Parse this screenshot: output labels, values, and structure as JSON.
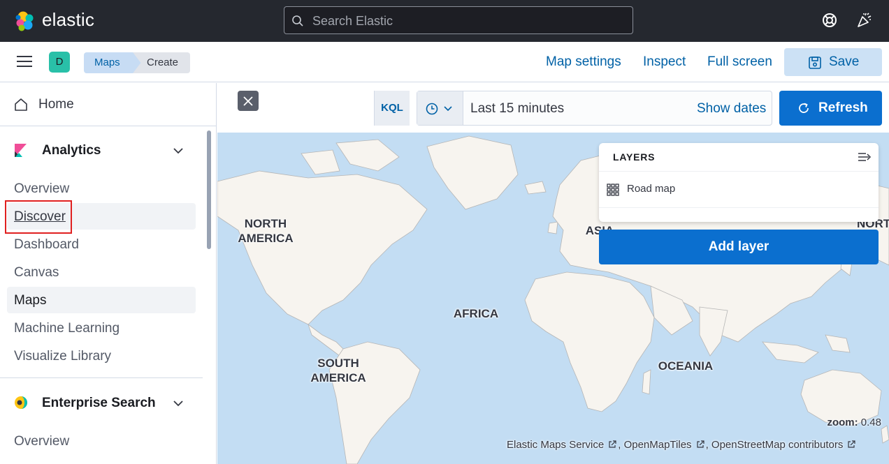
{
  "header": {
    "brand": "elastic",
    "search_placeholder": "Search Elastic",
    "icons": [
      "help-lifebuoy-icon",
      "news-feed-icon"
    ]
  },
  "toolbar": {
    "space_initial": "D",
    "breadcrumbs": [
      "Maps",
      "Create"
    ],
    "map_settings": "Map settings",
    "inspect": "Inspect",
    "full_screen": "Full screen",
    "save": "Save"
  },
  "sidebar": {
    "home": "Home",
    "groups": [
      {
        "title": "Analytics",
        "icon": "kibana-logo-icon",
        "items": [
          "Overview",
          "Discover",
          "Dashboard",
          "Canvas",
          "Maps",
          "Machine Learning",
          "Visualize Library"
        ],
        "active": "Maps",
        "highlighted": "Discover"
      },
      {
        "title": "Enterprise Search",
        "icon": "enterprise-search-logo-icon",
        "items": [
          "Overview"
        ]
      }
    ]
  },
  "query": {
    "language": "KQL",
    "time_range": "Last 15 minutes",
    "show_dates": "Show dates",
    "refresh": "Refresh"
  },
  "map": {
    "labels": {
      "north_america": "NORTH AMERICA",
      "south_america": "SOUTH AMERICA",
      "africa": "AFRICA",
      "asia": "ASIA",
      "oceania": "OCEANIA",
      "north_cut": "NORT R"
    },
    "layers_title": "LAYERS",
    "layers": [
      "Road map"
    ],
    "add_layer": "Add layer",
    "zoom_label": "zoom:",
    "zoom_value": "0.48",
    "attribution": [
      "Elastic Maps Service",
      "OpenMapTiles",
      "OpenStreetMap contributors"
    ]
  },
  "colors": {
    "header_bg": "#25282f",
    "primary": "#0b6fcf",
    "link": "#0061a6",
    "water": "#c3ddf3",
    "land": "#f7f4ef",
    "highlight_box": "#e02020"
  }
}
